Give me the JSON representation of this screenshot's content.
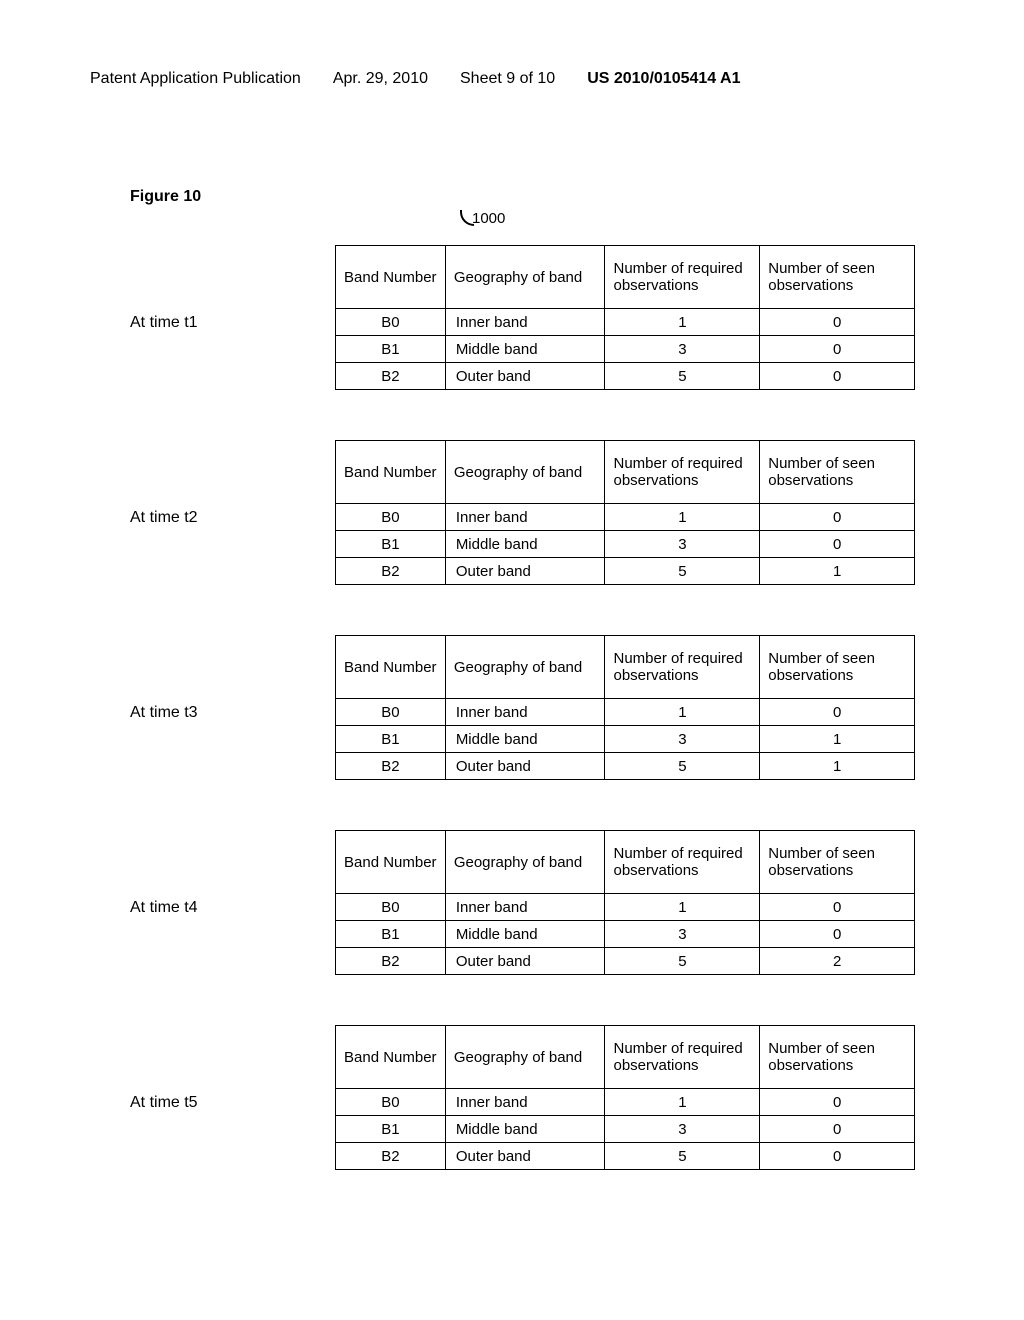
{
  "header": {
    "title": "Patent Application Publication",
    "date": "Apr. 29, 2010",
    "sheet": "Sheet 9 of 10",
    "pub": "US 2010/0105414 A1"
  },
  "figure_label": "Figure 10",
  "ref_number": "1000",
  "columns": {
    "band": "Band Number",
    "geo": "Geography of band",
    "req": "Number of required observations",
    "seen": "Number of seen observations"
  },
  "tables": [
    {
      "time": "At time t1",
      "rows": [
        {
          "band": "B0",
          "geo": "Inner band",
          "req": "1",
          "seen": "0"
        },
        {
          "band": "B1",
          "geo": "Middle band",
          "req": "3",
          "seen": "0"
        },
        {
          "band": "B2",
          "geo": "Outer band",
          "req": "5",
          "seen": "0"
        }
      ]
    },
    {
      "time": "At time t2",
      "rows": [
        {
          "band": "B0",
          "geo": "Inner band",
          "req": "1",
          "seen": "0"
        },
        {
          "band": "B1",
          "geo": "Middle band",
          "req": "3",
          "seen": "0"
        },
        {
          "band": "B2",
          "geo": "Outer band",
          "req": "5",
          "seen": "1"
        }
      ]
    },
    {
      "time": "At time t3",
      "rows": [
        {
          "band": "B0",
          "geo": "Inner band",
          "req": "1",
          "seen": "0"
        },
        {
          "band": "B1",
          "geo": "Middle band",
          "req": "3",
          "seen": "1"
        },
        {
          "band": "B2",
          "geo": "Outer band",
          "req": "5",
          "seen": "1"
        }
      ]
    },
    {
      "time": "At time t4",
      "rows": [
        {
          "band": "B0",
          "geo": "Inner band",
          "req": "1",
          "seen": "0"
        },
        {
          "band": "B1",
          "geo": "Middle band",
          "req": "3",
          "seen": "0"
        },
        {
          "band": "B2",
          "geo": "Outer band",
          "req": "5",
          "seen": "2"
        }
      ]
    },
    {
      "time": "At time t5",
      "rows": [
        {
          "band": "B0",
          "geo": "Inner band",
          "req": "1",
          "seen": "0"
        },
        {
          "band": "B1",
          "geo": "Middle band",
          "req": "3",
          "seen": "0"
        },
        {
          "band": "B2",
          "geo": "Outer band",
          "req": "5",
          "seen": "0"
        }
      ]
    }
  ]
}
